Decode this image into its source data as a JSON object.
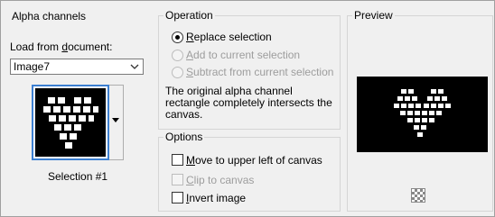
{
  "alpha_channels": {
    "title": "Alpha channels",
    "load_label_prefix": "Load from ",
    "load_label_underlined": "d",
    "load_label_suffix": "ocument:",
    "document_value": "Image7",
    "selection_caption": "Selection #1"
  },
  "operation": {
    "title": "Operation",
    "options": [
      {
        "underlined": "R",
        "rest": "eplace selection",
        "selected": true,
        "enabled": true
      },
      {
        "underlined": "A",
        "rest": "dd to current selection",
        "selected": false,
        "enabled": false
      },
      {
        "underlined": "S",
        "rest": "ubtract from current selection",
        "selected": false,
        "enabled": false
      }
    ],
    "message_line1": "The original alpha channel",
    "message_line2": "rectangle completely intersects the",
    "message_line3": "canvas."
  },
  "options": {
    "title": "Options",
    "items": [
      {
        "underlined": "M",
        "rest": "ove to upper left of canvas",
        "checked": false,
        "enabled": true
      },
      {
        "underlined": "C",
        "rest": "lip to canvas",
        "checked": false,
        "enabled": false
      },
      {
        "underlined": "I",
        "rest": "nvert image",
        "checked": false,
        "enabled": true
      }
    ]
  },
  "preview": {
    "title": "Preview",
    "mini_icon": "checkerboard-icon"
  }
}
